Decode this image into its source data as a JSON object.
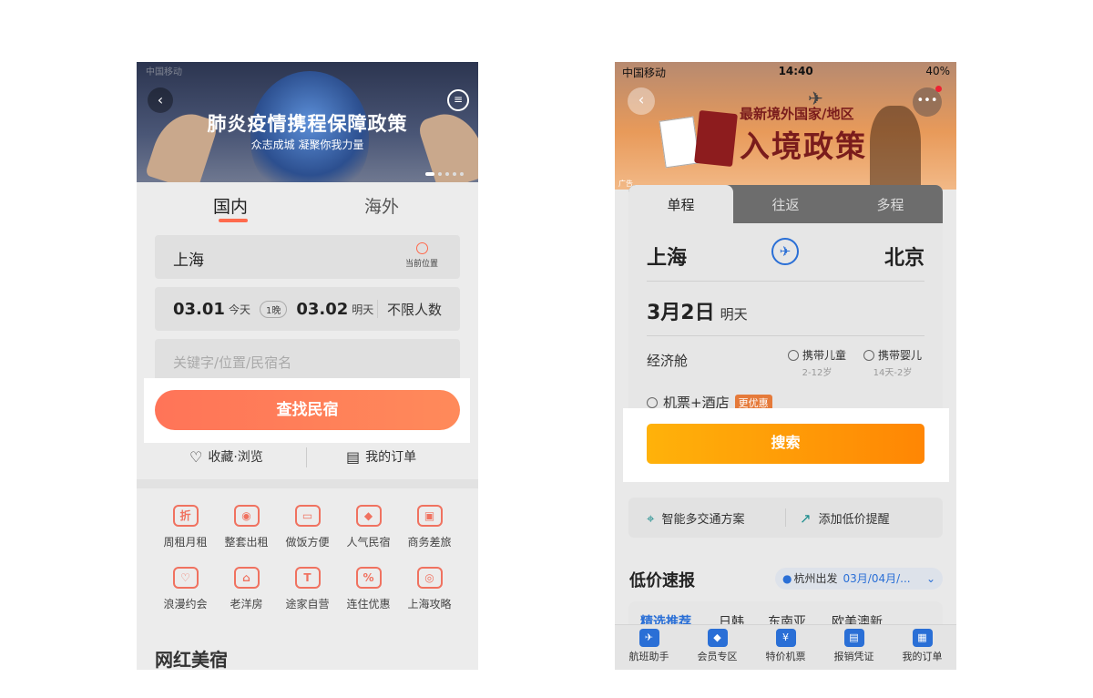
{
  "left": {
    "status_bar": "中国移动",
    "banner": {
      "title": "肺炎疫情携程保障政策",
      "subtitle": "众志成城 凝聚你我力量"
    },
    "tabs": [
      "国内",
      "海外"
    ],
    "city": "上海",
    "locate_label": "当前位置",
    "checkin": {
      "date": "03.01",
      "day": "今天"
    },
    "nights": "1晚",
    "checkout": {
      "date": "03.02",
      "day": "明天"
    },
    "guests": "不限人数",
    "keyword_placeholder": "关键字/位置/民宿名",
    "search_button": "查找民宿",
    "links": {
      "favorites": "收藏·浏览",
      "orders": "我的订单"
    },
    "grid": [
      {
        "label": "周租月租",
        "glyph": "折"
      },
      {
        "label": "整套出租",
        "glyph": "◉"
      },
      {
        "label": "做饭方便",
        "glyph": "▭"
      },
      {
        "label": "人气民宿",
        "glyph": "◆"
      },
      {
        "label": "商务差旅",
        "glyph": "▣"
      },
      {
        "label": "浪漫约会",
        "glyph": "♡"
      },
      {
        "label": "老洋房",
        "glyph": "⌂"
      },
      {
        "label": "途家自营",
        "glyph": "T"
      },
      {
        "label": "连住优惠",
        "glyph": "%"
      },
      {
        "label": "上海攻略",
        "glyph": "◎"
      }
    ],
    "section_title": "网红美宿"
  },
  "right": {
    "status": {
      "carrier": "中国移动",
      "time": "14:40",
      "battery": "40%"
    },
    "banner": {
      "line1": "最新境外国家/地区",
      "line2": "入境政策",
      "ad": "广告"
    },
    "tabs": [
      "单程",
      "往返",
      "多程"
    ],
    "from_city": "上海",
    "to_city": "北京",
    "date": {
      "value": "3月2日",
      "day": "明天"
    },
    "cabin": "经济舱",
    "child": {
      "label": "携带儿童",
      "sub": "2-12岁"
    },
    "infant": {
      "label": "携带婴儿",
      "sub": "14天-2岁"
    },
    "combo": {
      "label": "机票+酒店",
      "tag": "更优惠"
    },
    "search_button": "搜索",
    "tools": {
      "transport": "智能多交通方案",
      "alert": "添加低价提醒"
    },
    "deals_title": "低价速报",
    "departure": {
      "city": "杭州出发",
      "dates": "03月/04月/..."
    },
    "categories": [
      "精选推荐",
      "日韩",
      "东南亚",
      "欧美澳新"
    ],
    "nav": [
      {
        "label": "航班助手",
        "glyph": "✈"
      },
      {
        "label": "会员专区",
        "glyph": "◆"
      },
      {
        "label": "特价机票",
        "glyph": "¥"
      },
      {
        "label": "报销凭证",
        "glyph": "▤"
      },
      {
        "label": "我的订单",
        "glyph": "▦"
      }
    ]
  },
  "colors": {
    "coral": "#ff7458",
    "orange": "#ff8604",
    "blue": "#2a6fd6"
  }
}
